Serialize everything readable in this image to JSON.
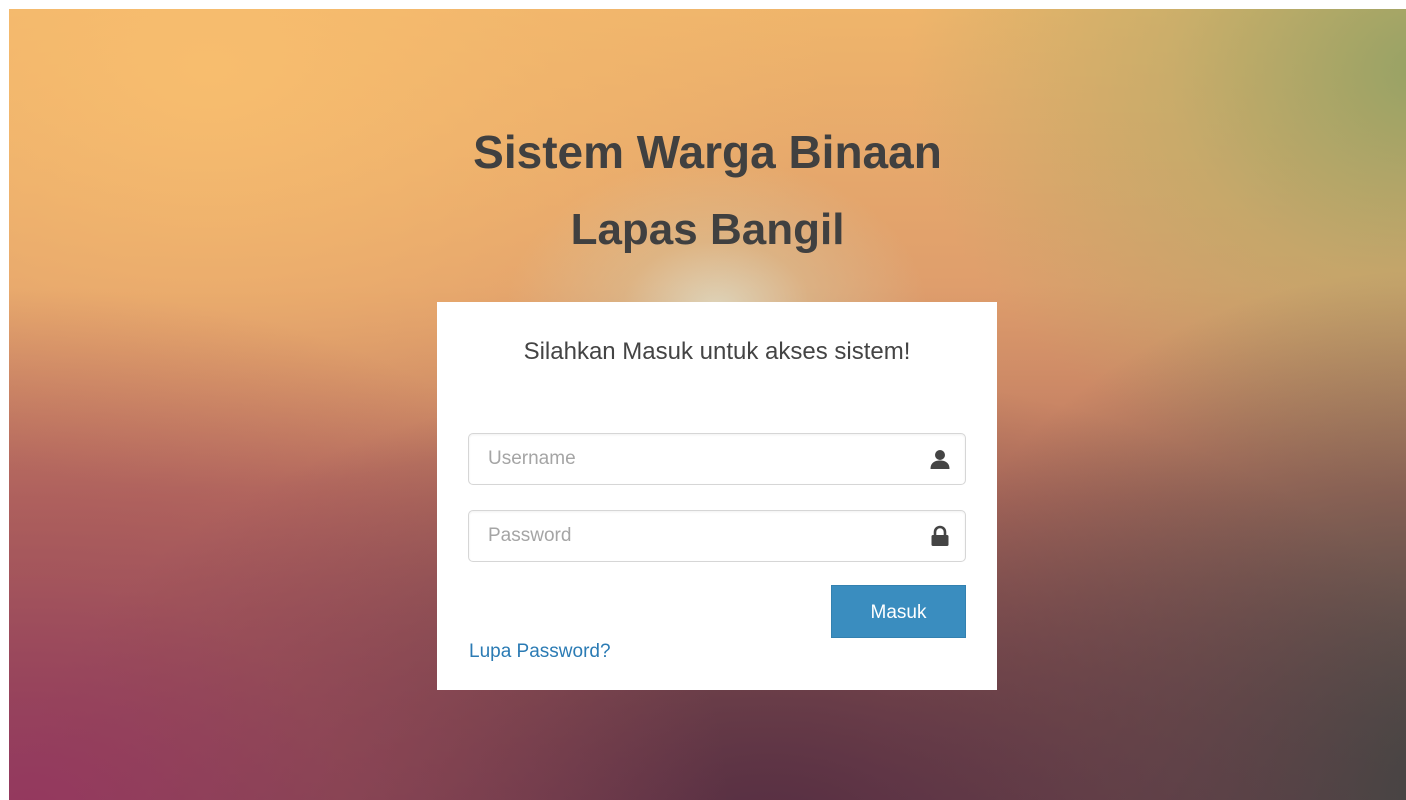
{
  "header": {
    "title": "Sistem Warga Binaan",
    "subtitle": "Lapas Bangil"
  },
  "login": {
    "message": "Silahkan Masuk untuk akses sistem!",
    "username": {
      "placeholder": "Username",
      "value": "",
      "icon": "user-icon"
    },
    "password": {
      "placeholder": "Password",
      "value": "",
      "icon": "lock-icon"
    },
    "submit_label": "Masuk",
    "forgot_label": "Lupa Password?"
  },
  "colors": {
    "button": "#3a8dbf",
    "link": "#2b7bb4",
    "heading": "#404040",
    "panel": "#ffffff"
  }
}
